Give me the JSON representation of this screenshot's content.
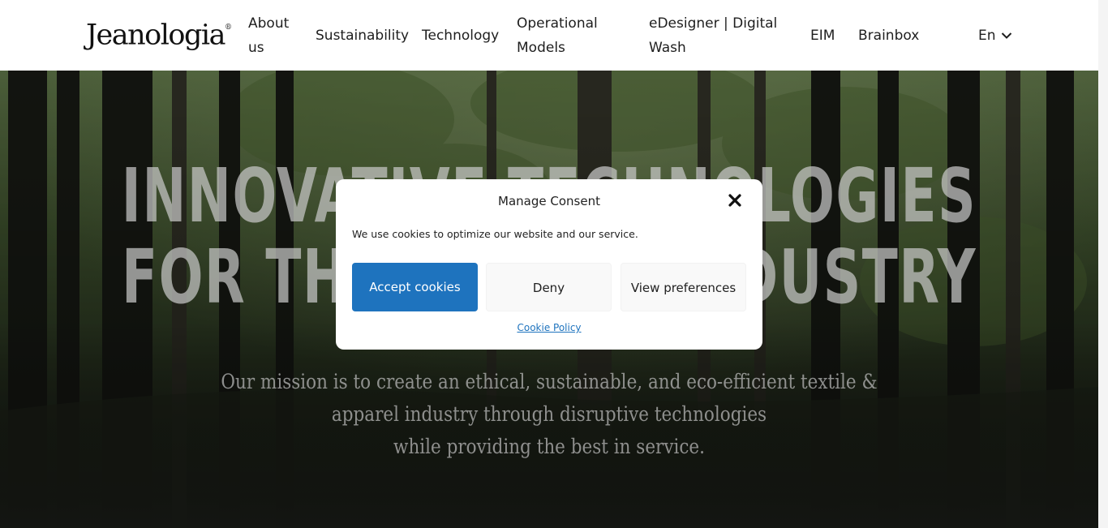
{
  "header": {
    "logo_text": "Jeanologia",
    "logo_mark": "®",
    "nav": [
      {
        "label": "About us"
      },
      {
        "label": "Sustainability"
      },
      {
        "label": "Technology"
      },
      {
        "label": "Operational Models"
      },
      {
        "label": "eDesigner | Digital Wash"
      },
      {
        "label": "EIM"
      },
      {
        "label": "Brainbox"
      }
    ],
    "language": {
      "label": "En",
      "icon": "chevron-down-icon"
    }
  },
  "hero": {
    "title_line1": "INNOVATIVE TECHNOLOGIES",
    "title_line2": "FOR THE TEXTILE INDUSTRY",
    "mission_line1": "Our mission is to create an ethical, sustainable, and eco-efficient textile &",
    "mission_line2": "apparel industry through disruptive technologies",
    "mission_line3": "while providing the best in service."
  },
  "consent": {
    "title": "Manage Consent",
    "close_icon": "close-icon",
    "message": "We use cookies to optimize our website and our service.",
    "accept_label": "Accept cookies",
    "deny_label": "Deny",
    "preferences_label": "View preferences",
    "policy_link": "Cookie Policy"
  },
  "colors": {
    "accent": "#1e73be",
    "header_bg": "#ffffff",
    "modal_bg": "#ffffff"
  }
}
